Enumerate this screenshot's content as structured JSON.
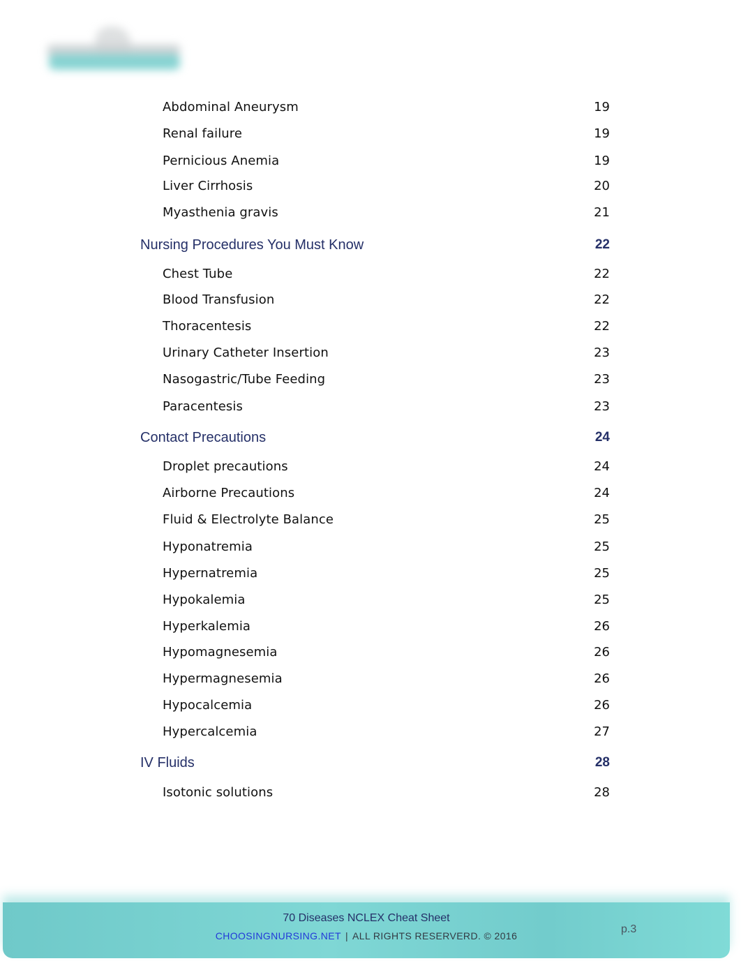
{
  "logo": {
    "name": "logo-blurred"
  },
  "toc": [
    {
      "type": "item",
      "label": "Abdominal Aneurysm",
      "page": "19"
    },
    {
      "type": "item",
      "label": "Renal failure",
      "page": "19"
    },
    {
      "type": "item",
      "label": "Pernicious Anemia",
      "page": "19"
    },
    {
      "type": "item",
      "label": "Liver Cirrhosis",
      "page": "20"
    },
    {
      "type": "item",
      "label": "Myasthenia gravis",
      "page": "21"
    },
    {
      "type": "section",
      "label": "Nursing Procedures You Must Know",
      "page": "22"
    },
    {
      "type": "item",
      "label": "Chest Tube",
      "page": "22"
    },
    {
      "type": "item",
      "label": "Blood Transfusion",
      "page": "22"
    },
    {
      "type": "item",
      "label": "Thoracentesis",
      "page": "22"
    },
    {
      "type": "item",
      "label": "Urinary Catheter Insertion",
      "page": "23"
    },
    {
      "type": "item",
      "label": "Nasogastric/Tube Feeding",
      "page": "23"
    },
    {
      "type": "item",
      "label": "Paracentesis",
      "page": "23"
    },
    {
      "type": "section",
      "label": "Contact Precautions",
      "page": "24"
    },
    {
      "type": "item",
      "label": "Droplet precautions",
      "page": "24"
    },
    {
      "type": "item",
      "label": "Airborne Precautions",
      "page": "24"
    },
    {
      "type": "item",
      "label": "Fluid & Electrolyte Balance",
      "page": "25"
    },
    {
      "type": "item",
      "label": "Hyponatremia",
      "page": "25"
    },
    {
      "type": "item",
      "label": "Hypernatremia",
      "page": "25"
    },
    {
      "type": "item",
      "label": "Hypokalemia",
      "page": "25"
    },
    {
      "type": "item",
      "label": "Hyperkalemia",
      "page": "26"
    },
    {
      "type": "item",
      "label": "Hypomagnesemia",
      "page": "26"
    },
    {
      "type": "item",
      "label": "Hypermagnesemia",
      "page": "26"
    },
    {
      "type": "item",
      "label": "Hypocalcemia",
      "page": "26"
    },
    {
      "type": "item",
      "label": "Hypercalcemia",
      "page": "27"
    },
    {
      "type": "section",
      "label": "IV Fluids",
      "page": "28"
    },
    {
      "type": "item",
      "label": "Isotonic solutions",
      "page": "28"
    }
  ],
  "footer": {
    "title": "70 Diseases NCLEX Cheat Sheet",
    "site": "CHOOSINGNURSING.NET",
    "separator": "|",
    "rights": "ALL RIGHTS RESERVERD. © 2016",
    "page_number": "p.3"
  },
  "colors": {
    "heading": "#253068",
    "body_text": "#111111",
    "footer_teal": "#7fd7d5",
    "link_blue": "#2239d8"
  }
}
